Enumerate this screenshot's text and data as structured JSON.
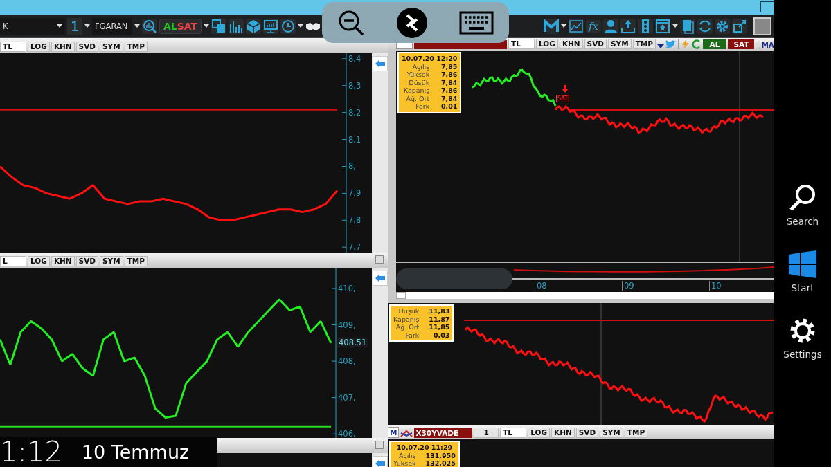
{
  "toolbar": {
    "account": "K",
    "count": "1",
    "symbol": "FGARAN",
    "buy": "AL",
    "sell": "SAT",
    "fx": "fx"
  },
  "left_top": {
    "tabs": [
      "TL",
      "LOG",
      "KHN",
      "SVD",
      "SYM",
      "TMP"
    ],
    "chart_data": {
      "type": "line",
      "ylim": [
        7.68,
        8.42
      ],
      "yticks": [
        {
          "value": 8.4,
          "label": "8,4"
        },
        {
          "value": 8.3,
          "label": "8,3"
        },
        {
          "value": 8.2,
          "label": "8,2"
        },
        {
          "value": 8.1,
          "label": "8,1"
        },
        {
          "value": 8.0,
          "label": "8,"
        },
        {
          "value": 7.9,
          "label": "7,9"
        },
        {
          "value": 7.8,
          "label": "7,8"
        },
        {
          "value": 7.7,
          "label": "7,7"
        }
      ],
      "series": [
        {
          "color": "#ff1010",
          "values": [
            8.0,
            7.96,
            7.93,
            7.92,
            7.9,
            7.89,
            7.88,
            7.9,
            7.93,
            7.88,
            7.87,
            7.86,
            7.87,
            7.87,
            7.88,
            7.87,
            7.86,
            7.84,
            7.81,
            7.8,
            7.8,
            7.81,
            7.82,
            7.83,
            7.84,
            7.84,
            7.83,
            7.84,
            7.86,
            7.91
          ]
        },
        {
          "color": "#d01010",
          "values": [
            8.21,
            8.21,
            8.21,
            8.21,
            8.21,
            8.21,
            8.21,
            8.21,
            8.21,
            8.21,
            8.21,
            8.21,
            8.21,
            8.21,
            8.21,
            8.21,
            8.21,
            8.21,
            8.21,
            8.21,
            8.21,
            8.21,
            8.21,
            8.21,
            8.21,
            8.21,
            8.21,
            8.21,
            8.21,
            8.21
          ]
        }
      ]
    }
  },
  "left_bottom": {
    "tabs": [
      "L",
      "LOG",
      "KHN",
      "SVD",
      "SYM",
      "TMP"
    ],
    "chart_data": {
      "type": "line",
      "ylim": [
        405.89,
        410.57
      ],
      "yticks": [
        {
          "value": 410,
          "label": "410,"
        },
        {
          "value": 409,
          "label": "409,"
        },
        {
          "value": 408,
          "label": "408,"
        },
        {
          "value": 407,
          "label": "407,"
        },
        {
          "value": 406,
          "label": "406,"
        }
      ],
      "series": [
        {
          "color": "#22ee22",
          "values": [
            408.6,
            407.9,
            408.8,
            409.1,
            408.9,
            408.6,
            408.0,
            408.2,
            407.8,
            407.6,
            408.6,
            408.8,
            408.0,
            408.1,
            407.6,
            406.7,
            406.45,
            406.5,
            407.4,
            407.7,
            408.0,
            408.6,
            408.8,
            408.4,
            408.8,
            409.1,
            409.4,
            409.7,
            409.4,
            409.5,
            408.8,
            409.1,
            408.5
          ]
        },
        {
          "color": "#22dd22",
          "values": [
            406.2,
            406.2,
            406.2,
            406.2,
            406.2,
            406.2,
            406.2,
            406.2,
            406.2,
            406.2,
            406.2,
            406.2,
            406.2,
            406.2,
            406.2,
            406.2,
            406.2,
            406.2,
            406.2,
            406.2,
            406.2,
            406.2,
            406.2,
            406.2,
            406.2,
            406.2,
            406.2,
            406.2,
            406.2,
            406.2,
            406.2,
            406.2,
            406.2
          ]
        }
      ],
      "annotations": [
        {
          "text": "408,51",
          "y": 408.51
        }
      ]
    }
  },
  "right_top": {
    "tabs": [
      "TL",
      "LOG",
      "KHN",
      "SVD",
      "SYM",
      "TMP"
    ],
    "buy": "AL",
    "sell": "SAT",
    "cut_label": "MA",
    "info": {
      "date": "10.07.20 12:20",
      "rows": [
        {
          "label": "Açılış",
          "value": "7,85"
        },
        {
          "label": "Yüksek",
          "value": "7,86"
        },
        {
          "label": "Düşük",
          "value": "7,84"
        },
        {
          "label": "Kapanış",
          "value": "7,86"
        },
        {
          "label": "Ağ. Ort",
          "value": "7,84"
        },
        {
          "label": "Fark",
          "value": "0,01"
        }
      ]
    },
    "signal": "SAT",
    "x_labels": [
      "08",
      "09",
      "10"
    ]
  },
  "right_middle": {
    "info": {
      "rows": [
        {
          "label": "Düşük",
          "value": "11,83"
        },
        {
          "label": "Kapanış",
          "value": "11,87"
        },
        {
          "label": "Ağ. Ort",
          "value": "11,85"
        },
        {
          "label": "Fark",
          "value": "0,03"
        }
      ]
    }
  },
  "right_bottom": {
    "logo": "M",
    "symbol": "X30YVADE",
    "count": "1",
    "tabs": [
      "TL",
      "LOG",
      "KHN",
      "SVD",
      "SYM",
      "TMP"
    ],
    "info": {
      "date": "10.07.20 11:29",
      "rows": [
        {
          "label": "Açılış",
          "value": "131,950"
        },
        {
          "label": "Yüksek",
          "value": "132,025"
        }
      ]
    }
  },
  "lock_screen": {
    "time": "1:12",
    "date": "10 Temmuz"
  },
  "charms": [
    {
      "kind": "search",
      "label": "Search"
    },
    {
      "kind": "start",
      "label": "Start"
    },
    {
      "kind": "settings",
      "label": "Settings"
    }
  ]
}
